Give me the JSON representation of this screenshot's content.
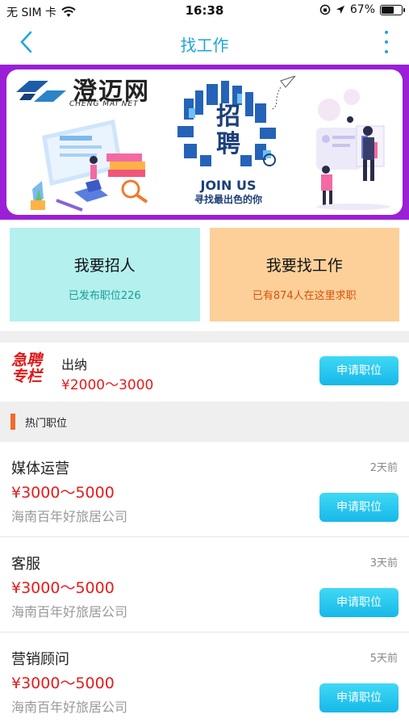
{
  "status_bar": {
    "carrier": "无 SIM 卡",
    "time": "16:38",
    "battery_percent": "67%",
    "battery_level": 0.67
  },
  "nav": {
    "title": "找工作"
  },
  "banner": {
    "logo_text": "澄迈网",
    "logo_sub": "CHENG MAI NET",
    "headline_top": "招",
    "headline_bottom": "聘",
    "join": "JOIN US",
    "slogan": "寻找最出色的你"
  },
  "cards": [
    {
      "title": "我要招人",
      "sub": "已发布职位226"
    },
    {
      "title": "我要找工作",
      "sub": "已有874人在这里求职"
    }
  ],
  "urgent": {
    "badge_line1": "急聘",
    "badge_line2": "专栏",
    "title": "出纳",
    "salary": "¥2000～3000",
    "apply_label": "申请职位"
  },
  "section": {
    "title": "热门职位"
  },
  "jobs": [
    {
      "title": "媒体运营",
      "salary": "¥3000～5000",
      "company": "海南百年好旅居公司",
      "posted": "2天前",
      "apply_label": "申请职位"
    },
    {
      "title": "客服",
      "salary": "¥3000～5000",
      "company": "海南百年好旅居公司",
      "posted": "3天前",
      "apply_label": "申请职位"
    },
    {
      "title": "营销顾问",
      "salary": "¥3000～5000",
      "company": "海南百年好旅居公司",
      "posted": "5天前",
      "apply_label": "申请职位"
    }
  ],
  "colors": {
    "accent": "#1ea6d9",
    "banner_frame": "#9b1fd6",
    "salary_red": "#e61b1b",
    "hire_card": "#b3f0ee",
    "find_card": "#fdd09a"
  }
}
